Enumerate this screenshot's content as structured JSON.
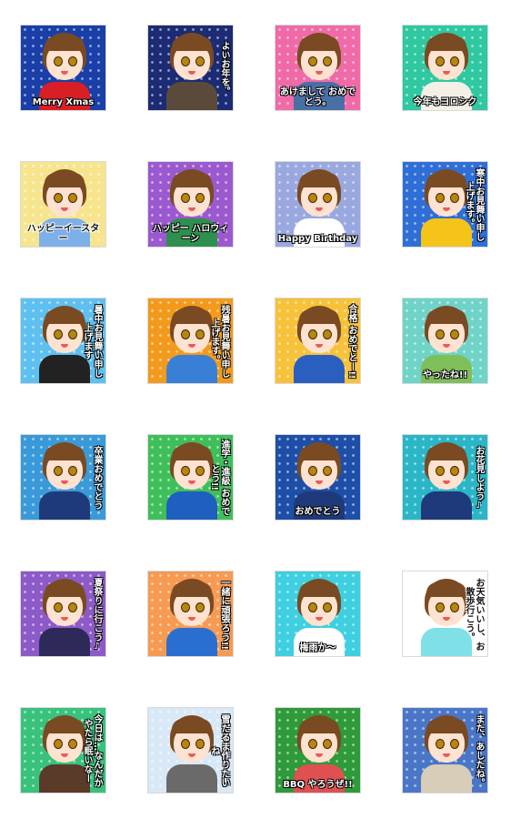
{
  "stickers": [
    {
      "id": "merry-xmas",
      "text": "Merry Xmas",
      "bg": "#1a3fa8",
      "accent": "#d81f26",
      "vertical": false
    },
    {
      "id": "yoi-otoshi",
      "text": "よいお年を。",
      "bg": "#1b2b74",
      "accent": "#5b4a3a",
      "vertical": true
    },
    {
      "id": "akemashite",
      "text": "あけまして おめでとう。",
      "bg": "#f06aa8",
      "accent": "#4a6fa5",
      "vertical": false
    },
    {
      "id": "kotoshimo",
      "text": "今年もヨロシク",
      "bg": "#2fc8a0",
      "accent": "#f4f0e6",
      "vertical": false
    },
    {
      "id": "easter",
      "text": "ハッピーイースター",
      "bg": "#f6e58d",
      "accent": "#7db0e8",
      "vertical": false
    },
    {
      "id": "halloween",
      "text": "ハッピー ハロウィーン",
      "bg": "#9b59d0",
      "accent": "#2f8f4e",
      "vertical": false
    },
    {
      "id": "birthday",
      "text": "Happy Birthday",
      "bg": "#9aa8e0",
      "accent": "#ffffff",
      "vertical": false
    },
    {
      "id": "kanchu-mimai",
      "text": "寒中お見舞い申し上げます。",
      "bg": "#2f6ed6",
      "accent": "#f4c518",
      "vertical": true
    },
    {
      "id": "shochu-mimai",
      "text": "暑中お見舞い申し上げます",
      "bg": "#5ec0f0",
      "accent": "#222222",
      "vertical": true
    },
    {
      "id": "zansho-mimai",
      "text": "残暑お見舞い申し上げます。",
      "bg": "#f39a1c",
      "accent": "#3a7fd6",
      "vertical": true
    },
    {
      "id": "gokaku",
      "text": "合格 おめでとー!!",
      "bg": "#f7c23a",
      "accent": "#2a5fbf",
      "vertical": true
    },
    {
      "id": "yattane",
      "text": "やったね!!",
      "bg": "#6fd3c8",
      "accent": "#7fbf5a",
      "vertical": false
    },
    {
      "id": "sotsugyo",
      "text": "卒業おめでとう",
      "bg": "#3a9ad9",
      "accent": "#1f3a7a",
      "vertical": true
    },
    {
      "id": "shingaku",
      "text": "進学・進級 おめでとう!!",
      "bg": "#3fbf5a",
      "accent": "#1f5fbf",
      "vertical": true
    },
    {
      "id": "omedetou",
      "text": "おめでとう",
      "bg": "#1e4fa8",
      "accent": "#1f3a7a",
      "vertical": false
    },
    {
      "id": "ohanami",
      "text": "お花見しよう♪",
      "bg": "#2bb6c8",
      "accent": "#1f3a7a",
      "vertical": true
    },
    {
      "id": "natsumatsuri",
      "text": "夏祭りに行こう♪",
      "bg": "#8d5ac8",
      "accent": "#2d2a5a",
      "vertical": true
    },
    {
      "id": "isshoni",
      "text": "一緒に頑張ろう!!",
      "bg": "#f79a52",
      "accent": "#2a6fd0",
      "vertical": true
    },
    {
      "id": "tsuyu",
      "text": "梅雨か〜",
      "bg": "#3ecfe0",
      "accent": "#ffffff",
      "vertical": false
    },
    {
      "id": "otenki",
      "text": "お天気いいし、お散歩行こう。",
      "bg": "#ffffff",
      "accent": "#7fe0e8",
      "vertical": true
    },
    {
      "id": "kyou-wa",
      "text": "今日は…なんだかやたら眠いなー",
      "bg": "#38c27c",
      "accent": "#5a3a28",
      "vertical": true
    },
    {
      "id": "yukidaruma",
      "text": "雪だるま作りたいね",
      "bg": "#d8e8f6",
      "accent": "#6a6a6a",
      "vertical": true
    },
    {
      "id": "bbq",
      "text": "BBQ やろうぜ!!",
      "bg": "#2f9a3a",
      "accent": "#e05050",
      "vertical": false
    },
    {
      "id": "mata-ashita",
      "text": "また、あしたね。",
      "bg": "#4a76c8",
      "accent": "#d8cdb8",
      "vertical": true
    }
  ]
}
